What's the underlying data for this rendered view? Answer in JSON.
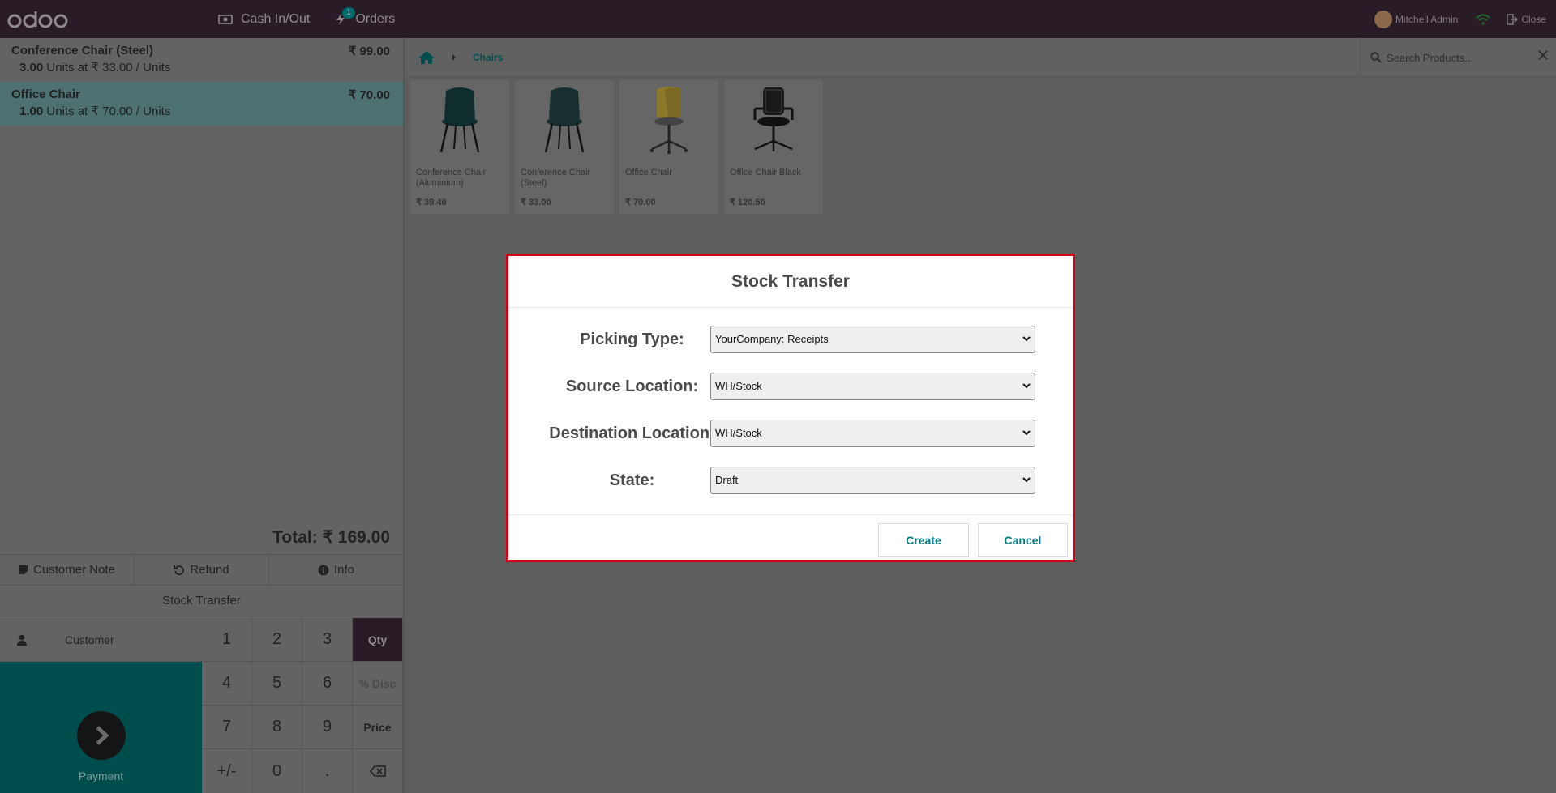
{
  "topbar": {
    "logo": "odoo",
    "cash_label": "Cash In/Out",
    "orders_label": "Orders",
    "orders_badge": "1",
    "user_name": "Mitchell Admin",
    "close_label": "Close"
  },
  "order": {
    "lines": [
      {
        "name": "Conference Chair (Steel)",
        "price": "₹ 99.00",
        "qty": "3.00",
        "unit_text": "Units at ₹ 33.00 / Units"
      },
      {
        "name": "Office Chair",
        "price": "₹ 70.00",
        "qty": "1.00",
        "unit_text": "Units at ₹ 70.00 / Units"
      }
    ],
    "total": "Total: ₹ 169.00"
  },
  "controls": {
    "customer_note": "Customer Note",
    "refund": "Refund",
    "info": "Info",
    "stock_transfer": "Stock Transfer",
    "customer": "Customer",
    "payment": "Payment"
  },
  "numpad": {
    "keys": [
      "1",
      "2",
      "3",
      "Qty",
      "4",
      "5",
      "6",
      "% Disc",
      "7",
      "8",
      "9",
      "Price",
      "+/-",
      "0",
      ".",
      "⌫"
    ]
  },
  "breadcrumb": {
    "category": "Chairs"
  },
  "search": {
    "placeholder": "Search Products..."
  },
  "products": [
    {
      "name": "Conference Chair (Aluminium)",
      "price": "₹ 39.40"
    },
    {
      "name": "Conference Chair (Steel)",
      "price": "₹ 33.00"
    },
    {
      "name": "Office Chair",
      "price": "₹ 70.00"
    },
    {
      "name": "Office Chair Black",
      "price": "₹ 120.50"
    }
  ],
  "modal": {
    "title": "Stock Transfer",
    "picking_type_label": "Picking Type:",
    "picking_type_value": "YourCompany: Receipts",
    "source_label": "Source Location:",
    "source_value": "WH/Stock",
    "dest_label": "Destination Location:",
    "dest_value": "WH/Stock",
    "state_label": "State:",
    "state_value": "Draft",
    "create_label": "Create",
    "cancel_label": "Cancel"
  },
  "colors": {
    "topbar": "#2a1c27",
    "accent_teal": "#017e84",
    "modal_border": "#d0021b",
    "payment_bg": "#004d4d"
  }
}
